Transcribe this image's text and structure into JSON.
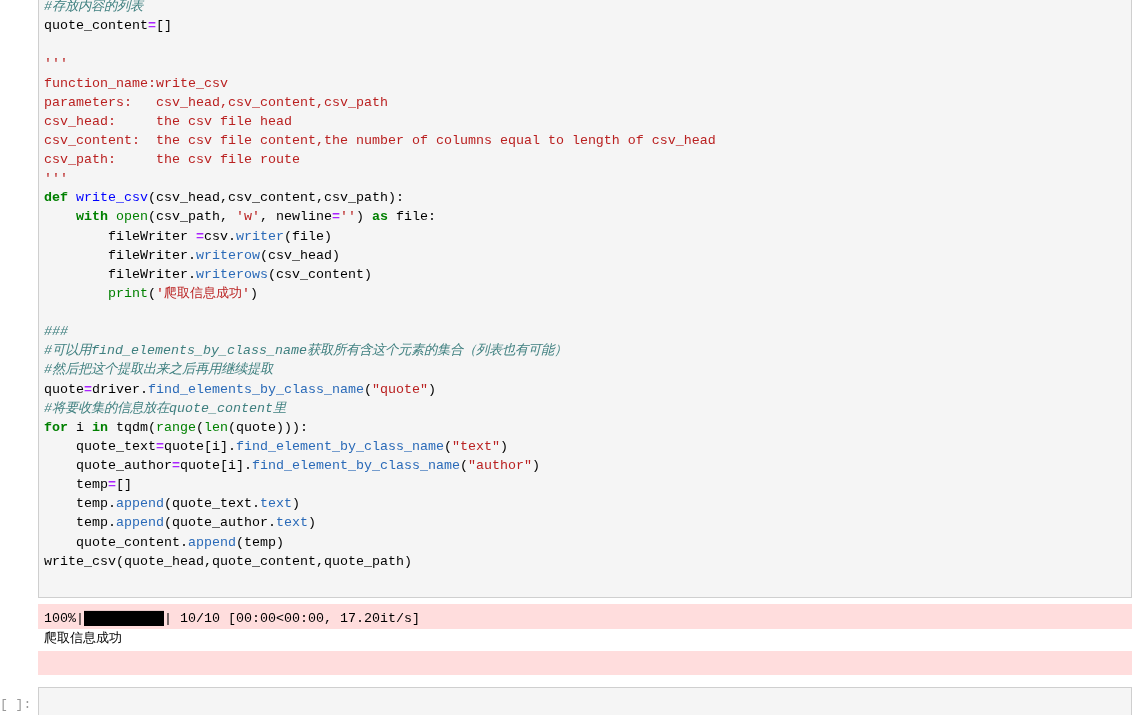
{
  "code_cell": {
    "lines": [
      {
        "kind": "code",
        "tokens": [
          {
            "kind": "com",
            "text": "#存放内容的列表"
          }
        ]
      },
      {
        "kind": "code",
        "tokens": [
          {
            "kind": "plain",
            "text": "quote_content"
          },
          {
            "kind": "op",
            "text": "="
          },
          {
            "kind": "plain",
            "text": "[]"
          }
        ]
      },
      {
        "kind": "blank"
      },
      {
        "kind": "code",
        "tokens": [
          {
            "kind": "doc",
            "text": "'''"
          }
        ]
      },
      {
        "kind": "code",
        "tokens": [
          {
            "kind": "doc",
            "text": "function_name:write_csv"
          }
        ]
      },
      {
        "kind": "code",
        "tokens": [
          {
            "kind": "doc",
            "text": "parameters:   csv_head,csv_content,csv_path"
          }
        ]
      },
      {
        "kind": "code",
        "tokens": [
          {
            "kind": "doc",
            "text": "csv_head:     the csv file head"
          }
        ]
      },
      {
        "kind": "code",
        "tokens": [
          {
            "kind": "doc",
            "text": "csv_content:  the csv file content,the number of columns equal to length of csv_head"
          }
        ]
      },
      {
        "kind": "code",
        "tokens": [
          {
            "kind": "doc",
            "text": "csv_path:     the csv file route"
          }
        ]
      },
      {
        "kind": "code",
        "tokens": [
          {
            "kind": "doc",
            "text": "'''"
          }
        ]
      },
      {
        "kind": "code",
        "tokens": [
          {
            "kind": "kw",
            "text": "def"
          },
          {
            "kind": "fn",
            "text": " write_csv"
          },
          {
            "kind": "plain",
            "text": "(csv_head,csv_content,csv_path):"
          }
        ]
      },
      {
        "kind": "code",
        "tokens": [
          {
            "kind": "kw",
            "text": "    with"
          },
          {
            "kind": "builtin",
            "text": " open"
          },
          {
            "kind": "plain",
            "text": "(csv_path, "
          },
          {
            "kind": "str",
            "text": "'w'"
          },
          {
            "kind": "plain",
            "text": ", newline"
          },
          {
            "kind": "op",
            "text": "="
          },
          {
            "kind": "str",
            "text": "''"
          },
          {
            "kind": "plain",
            "text": ") "
          },
          {
            "kind": "kw",
            "text": "as"
          },
          {
            "kind": "plain",
            "text": " file:"
          }
        ]
      },
      {
        "kind": "code",
        "tokens": [
          {
            "kind": "plain",
            "text": "        fileWriter "
          },
          {
            "kind": "op",
            "text": "="
          },
          {
            "kind": "plain",
            "text": "csv."
          },
          {
            "kind": "attr",
            "text": "writer"
          },
          {
            "kind": "plain",
            "text": "(file)"
          }
        ]
      },
      {
        "kind": "code",
        "tokens": [
          {
            "kind": "plain",
            "text": "        fileWriter."
          },
          {
            "kind": "attr",
            "text": "writerow"
          },
          {
            "kind": "plain",
            "text": "(csv_head)"
          }
        ]
      },
      {
        "kind": "code",
        "tokens": [
          {
            "kind": "plain",
            "text": "        fileWriter."
          },
          {
            "kind": "attr",
            "text": "writerows"
          },
          {
            "kind": "plain",
            "text": "(csv_content)"
          }
        ]
      },
      {
        "kind": "code",
        "tokens": [
          {
            "kind": "builtin",
            "text": "        print"
          },
          {
            "kind": "plain",
            "text": "("
          },
          {
            "kind": "str",
            "text": "'爬取信息成功'"
          },
          {
            "kind": "plain",
            "text": ")"
          }
        ]
      },
      {
        "kind": "blank"
      },
      {
        "kind": "code",
        "tokens": [
          {
            "kind": "com",
            "text": "###"
          }
        ]
      },
      {
        "kind": "code",
        "tokens": [
          {
            "kind": "com",
            "text": "#可以用find_elements_by_class_name获取所有含这个元素的集合（列表也有可能）"
          }
        ]
      },
      {
        "kind": "code",
        "tokens": [
          {
            "kind": "com",
            "text": "#然后把这个提取出来之后再用继续提取"
          }
        ]
      },
      {
        "kind": "code",
        "tokens": [
          {
            "kind": "plain",
            "text": "quote"
          },
          {
            "kind": "op",
            "text": "="
          },
          {
            "kind": "plain",
            "text": "driver."
          },
          {
            "kind": "attr",
            "text": "find_elements_by_class_name"
          },
          {
            "kind": "plain",
            "text": "("
          },
          {
            "kind": "str",
            "text": "\"quote\""
          },
          {
            "kind": "plain",
            "text": ")"
          }
        ]
      },
      {
        "kind": "code",
        "tokens": [
          {
            "kind": "com",
            "text": "#将要收集的信息放在quote_content里"
          }
        ]
      },
      {
        "kind": "code",
        "tokens": [
          {
            "kind": "kw",
            "text": "for"
          },
          {
            "kind": "plain",
            "text": " i "
          },
          {
            "kind": "kw",
            "text": "in"
          },
          {
            "kind": "plain",
            "text": " tqdm("
          },
          {
            "kind": "builtin",
            "text": "range"
          },
          {
            "kind": "plain",
            "text": "("
          },
          {
            "kind": "builtin",
            "text": "len"
          },
          {
            "kind": "plain",
            "text": "(quote))):"
          }
        ]
      },
      {
        "kind": "code",
        "tokens": [
          {
            "kind": "plain",
            "text": "    quote_text"
          },
          {
            "kind": "op",
            "text": "="
          },
          {
            "kind": "plain",
            "text": "quote[i]."
          },
          {
            "kind": "attr",
            "text": "find_element_by_class_name"
          },
          {
            "kind": "plain",
            "text": "("
          },
          {
            "kind": "str",
            "text": "\"text\""
          },
          {
            "kind": "plain",
            "text": ")"
          }
        ]
      },
      {
        "kind": "code",
        "tokens": [
          {
            "kind": "plain",
            "text": "    quote_author"
          },
          {
            "kind": "op",
            "text": "="
          },
          {
            "kind": "plain",
            "text": "quote[i]."
          },
          {
            "kind": "attr",
            "text": "find_element_by_class_name"
          },
          {
            "kind": "plain",
            "text": "("
          },
          {
            "kind": "str",
            "text": "\"author\""
          },
          {
            "kind": "plain",
            "text": ")"
          }
        ]
      },
      {
        "kind": "code",
        "tokens": [
          {
            "kind": "plain",
            "text": "    temp"
          },
          {
            "kind": "op",
            "text": "="
          },
          {
            "kind": "plain",
            "text": "[]"
          }
        ]
      },
      {
        "kind": "code",
        "tokens": [
          {
            "kind": "plain",
            "text": "    temp."
          },
          {
            "kind": "attr",
            "text": "append"
          },
          {
            "kind": "plain",
            "text": "(quote_text."
          },
          {
            "kind": "attr",
            "text": "text"
          },
          {
            "kind": "plain",
            "text": ")"
          }
        ]
      },
      {
        "kind": "code",
        "tokens": [
          {
            "kind": "plain",
            "text": "    temp."
          },
          {
            "kind": "attr",
            "text": "append"
          },
          {
            "kind": "plain",
            "text": "(quote_author."
          },
          {
            "kind": "attr",
            "text": "text"
          },
          {
            "kind": "plain",
            "text": ")"
          }
        ]
      },
      {
        "kind": "code",
        "tokens": [
          {
            "kind": "plain",
            "text": "    quote_content."
          },
          {
            "kind": "attr",
            "text": "append"
          },
          {
            "kind": "plain",
            "text": "(temp)"
          }
        ]
      },
      {
        "kind": "code",
        "tokens": [
          {
            "kind": "plain",
            "text": "write_csv(quote_head,quote_content,quote_path)"
          }
        ]
      }
    ]
  },
  "outputs": [
    {
      "kind": "stderr",
      "text": "100%|██████████| 10/10 [00:00<00:00, 17.20it/s]"
    },
    {
      "kind": "stdout",
      "text": "爬取信息成功"
    },
    {
      "kind": "stderr"
    }
  ],
  "next_cell": {
    "prompt": "[ ]:"
  }
}
